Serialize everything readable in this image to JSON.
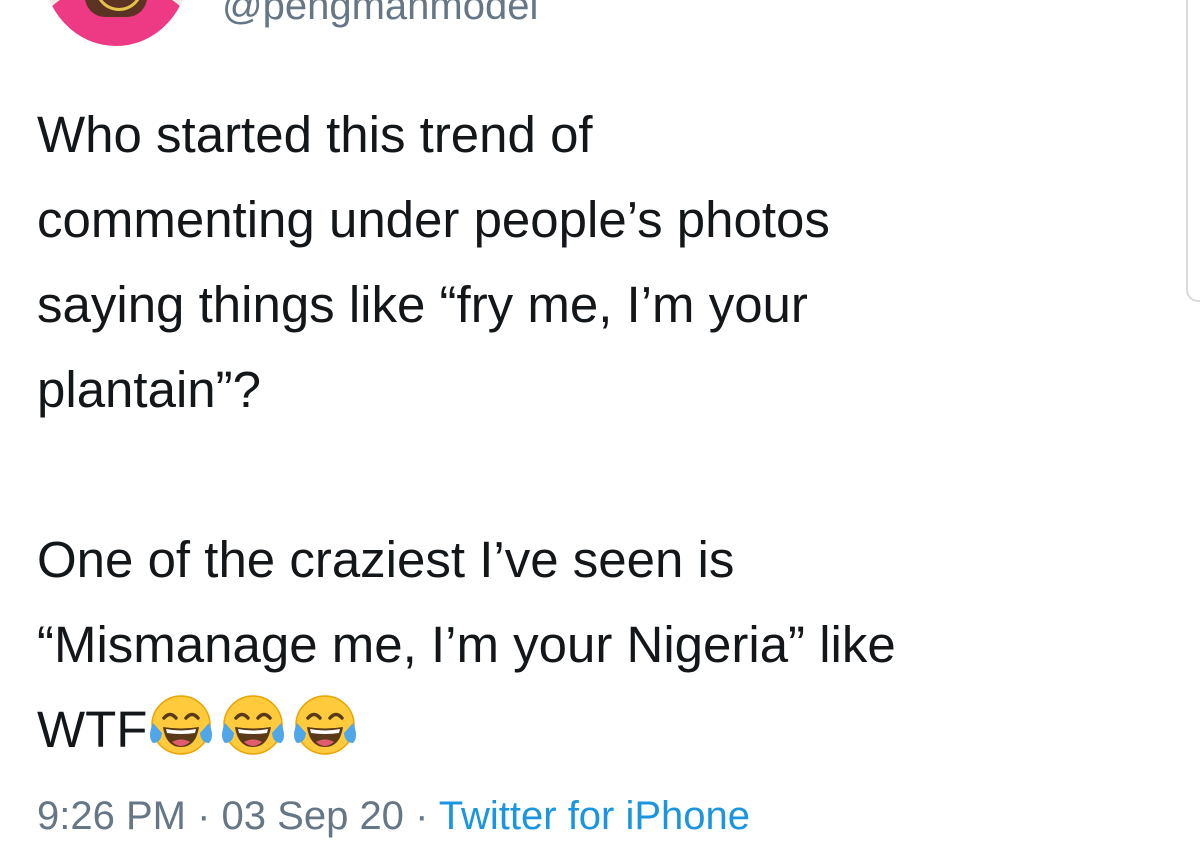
{
  "tweet": {
    "handle": "@pengmanmodel",
    "avatar_icon": "profile-photo",
    "text": {
      "line1": "Who started this trend of",
      "line2": "commenting under people’s photos",
      "line3": "saying things like “fry me, I’m your",
      "line4": "plantain”?",
      "line5": "One of the craziest I’ve seen is",
      "line6": "“Mismanage me, I’m your Nigeria” like",
      "line7_prefix": "WTF",
      "line7_emojis": [
        "face-with-tears-of-joy",
        "face-with-tears-of-joy",
        "face-with-tears-of-joy"
      ]
    },
    "time": "9:26 PM",
    "separator": "·",
    "date": "03 Sep 20",
    "source": "Twitter for iPhone"
  },
  "colors": {
    "text": "#14171a",
    "muted": "#657786",
    "link": "#1b95e0",
    "emoji": "#ffcb3d"
  }
}
